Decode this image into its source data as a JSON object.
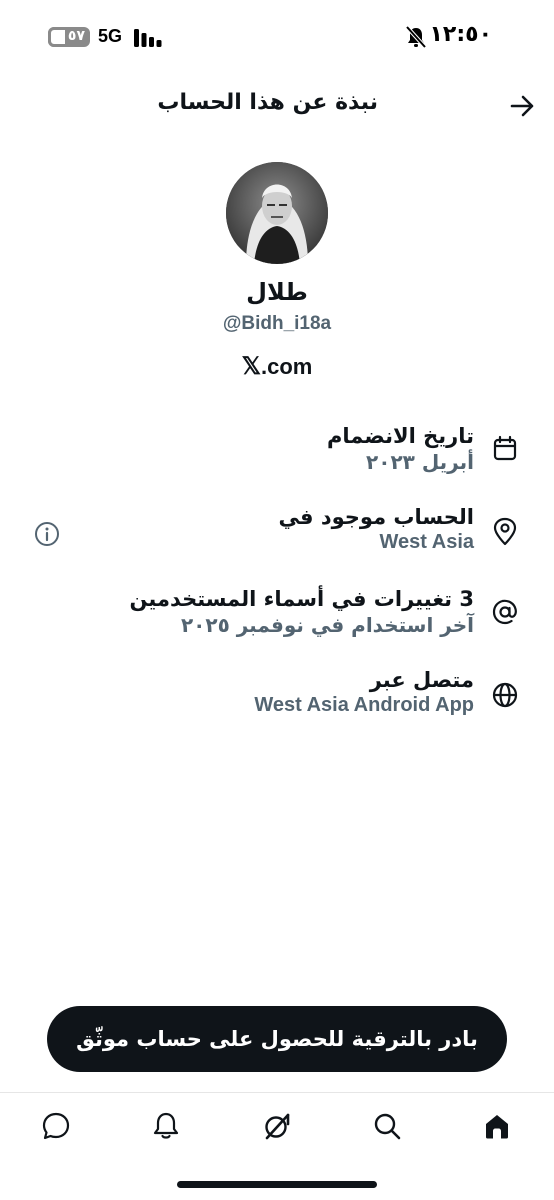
{
  "status_bar": {
    "time": "١٢:٥٠",
    "network": "5G",
    "battery": "٥٧"
  },
  "header": {
    "title": "نبذة عن هذا الحساب"
  },
  "profile": {
    "display_name": "طلال",
    "handle": "@Bidh_i18a",
    "website_logo": "𝕏",
    "website_rest": ".com"
  },
  "info_rows": [
    {
      "icon": "calendar-icon",
      "title": "تاريخ الانضمام",
      "subtitle": "أبريل ٢٠٢٣"
    },
    {
      "icon": "location-pin-icon",
      "title": "الحساب موجود في",
      "subtitle": "West Asia"
    },
    {
      "icon": "at-sign-icon",
      "title": "3 تغييرات في أسماء المستخدمين",
      "subtitle": "آخر استخدام في نوفمبر ٢٠٢٥"
    },
    {
      "icon": "globe-icon",
      "title": "متصل عبر",
      "subtitle": "West Asia Android App"
    }
  ],
  "upgrade_button": {
    "label": "بادر بالترقية للحصول على حساب موثّق"
  },
  "bottom_nav": {
    "items": [
      "messages-icon",
      "notifications-bell-icon",
      "grok-icon",
      "search-icon",
      "home-icon"
    ]
  },
  "colors": {
    "text": "#0f1419",
    "secondary": "#536471",
    "button_bg": "#0f1419"
  }
}
